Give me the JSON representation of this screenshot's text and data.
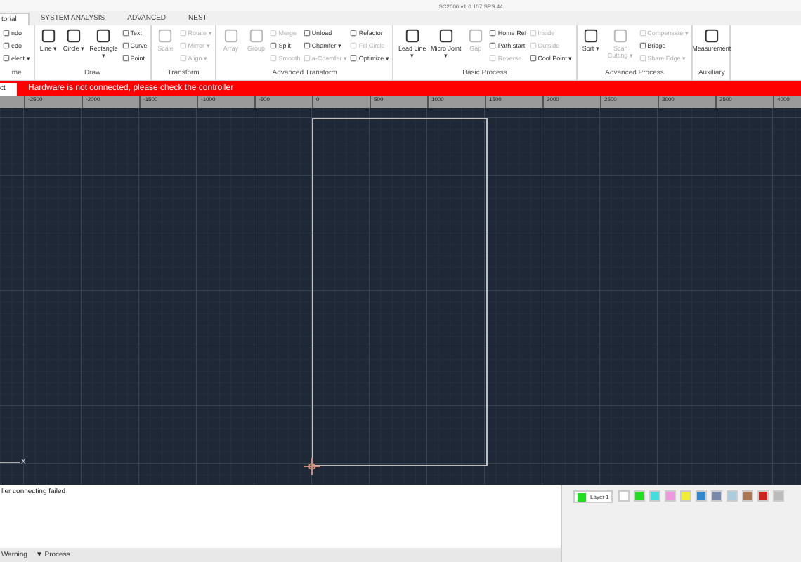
{
  "window": {
    "title": "SC2000 v1.0.107 SPS.44"
  },
  "tabs": [
    {
      "label": "torial",
      "selected": true
    },
    {
      "label": "SYSTEM ANALYSIS",
      "selected": false
    },
    {
      "label": "ADVANCED",
      "selected": false
    },
    {
      "label": "NEST",
      "selected": false
    }
  ],
  "ribbon": [
    {
      "label": "me",
      "items": [
        {
          "kind": "small",
          "label": "ndo",
          "disabled": false
        },
        {
          "kind": "small",
          "label": "edo",
          "disabled": false
        },
        {
          "kind": "small",
          "label": "elect ▾",
          "disabled": false
        }
      ]
    },
    {
      "label": "Draw",
      "items": [
        {
          "kind": "large",
          "label": "Line ▾",
          "disabled": false
        },
        {
          "kind": "large",
          "label": "Circle ▾",
          "disabled": false
        },
        {
          "kind": "large",
          "label": "Rectangle ▾",
          "disabled": false
        },
        {
          "kind": "small",
          "label": "Text",
          "disabled": false
        },
        {
          "kind": "small",
          "label": "Curve",
          "disabled": false
        },
        {
          "kind": "small",
          "label": "Point",
          "disabled": false
        }
      ]
    },
    {
      "label": "Transform",
      "items": [
        {
          "kind": "large",
          "label": "Scale",
          "disabled": true
        },
        {
          "kind": "small",
          "label": "Rotate ▾",
          "disabled": true
        },
        {
          "kind": "small",
          "label": "Mirror ▾",
          "disabled": true
        },
        {
          "kind": "small",
          "label": "Align ▾",
          "disabled": true
        }
      ]
    },
    {
      "label": "Advanced Transform",
      "items": [
        {
          "kind": "large",
          "label": "Array",
          "disabled": true
        },
        {
          "kind": "large",
          "label": "Group",
          "disabled": true
        },
        {
          "kind": "small",
          "label": "Merge",
          "disabled": true
        },
        {
          "kind": "small",
          "label": "Split",
          "disabled": false
        },
        {
          "kind": "small",
          "label": "Smooth",
          "disabled": true
        },
        {
          "kind": "small",
          "label": "Unload",
          "disabled": false
        },
        {
          "kind": "small",
          "label": "Chamfer ▾",
          "disabled": false
        },
        {
          "kind": "small",
          "label": "a-Chamfer ▾",
          "disabled": true
        },
        {
          "kind": "small",
          "label": "Refactor",
          "disabled": false
        },
        {
          "kind": "small",
          "label": "Fill Circle",
          "disabled": true
        },
        {
          "kind": "small",
          "label": "Optimize ▾",
          "disabled": false
        }
      ]
    },
    {
      "label": "Basic Process",
      "items": [
        {
          "kind": "large",
          "label": "Lead Line ▾",
          "disabled": false
        },
        {
          "kind": "large",
          "label": "Micro Joint ▾",
          "disabled": false
        },
        {
          "kind": "large",
          "label": "Gap",
          "disabled": true
        },
        {
          "kind": "small",
          "label": "Home Ref",
          "disabled": false
        },
        {
          "kind": "small",
          "label": "Path start",
          "disabled": false
        },
        {
          "kind": "small",
          "label": "Reverse",
          "disabled": true
        },
        {
          "kind": "small",
          "label": "Inside",
          "disabled": true
        },
        {
          "kind": "small",
          "label": "Outside",
          "disabled": true
        },
        {
          "kind": "small",
          "label": "Cool Point ▾",
          "disabled": false
        }
      ]
    },
    {
      "label": "Advanced Process",
      "items": [
        {
          "kind": "large",
          "label": "Sort ▾",
          "disabled": false
        },
        {
          "kind": "large",
          "label": "Scan Cutting ▾",
          "disabled": true
        },
        {
          "kind": "small",
          "label": "Compensate ▾",
          "disabled": true
        },
        {
          "kind": "small",
          "label": "Bridge",
          "disabled": false
        },
        {
          "kind": "small",
          "label": "Share Edge ▾",
          "disabled": true
        }
      ]
    },
    {
      "label": "Auxiliary",
      "items": [
        {
          "kind": "large",
          "label": "Measurement",
          "disabled": false
        }
      ]
    }
  ],
  "alert": {
    "field": "ct",
    "message": "Hardware is not connected, please check the controller"
  },
  "ruler": [
    "-2500",
    "-2000",
    "-1500",
    "-1000",
    "-500",
    "0",
    "500",
    "1000",
    "1500",
    "2000",
    "2500",
    "3000",
    "3500",
    "4000"
  ],
  "canvas": {
    "axis_label": "X"
  },
  "log": [
    "ller connecting failed"
  ],
  "status_tabs": [
    "Warning",
    "▼ Process"
  ],
  "layers": {
    "layer": {
      "label": "Layer 1",
      "color": "#22dd22"
    },
    "swatches": [
      {
        "color": "#ffffff"
      },
      {
        "color": "#22dd22"
      },
      {
        "color": "#44dddd"
      },
      {
        "color": "#ee99dd"
      },
      {
        "color": "#eeee33"
      },
      {
        "color": "#3388cc"
      },
      {
        "color": "#7788aa"
      },
      {
        "color": "#aaccdd"
      },
      {
        "color": "#aa7755"
      },
      {
        "color": "#cc2222"
      },
      {
        "color": "#bbbbbb"
      }
    ]
  }
}
